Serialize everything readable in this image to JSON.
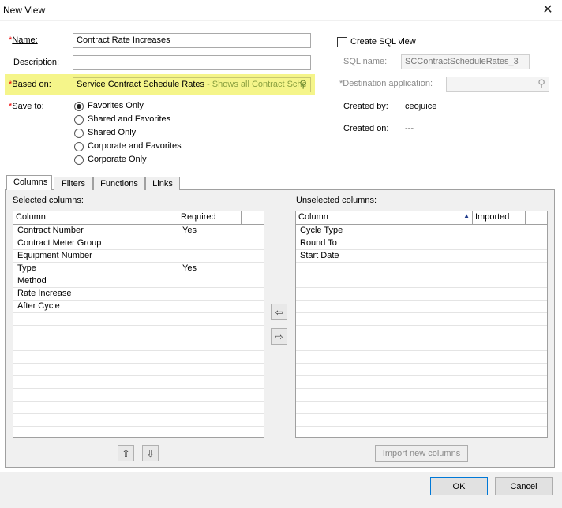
{
  "window": {
    "title": "New View",
    "close_glyph": "✕"
  },
  "form": {
    "name_label": "Name:",
    "name_value": "Contract Rate Increases",
    "description_label": "Description:",
    "description_value": "",
    "based_on_label": "Based on:",
    "based_on_value": "Service Contract Schedule Rates",
    "based_on_hint": " - Shows all Contract Sche",
    "save_to_label": "Save to:",
    "save_to_options": [
      "Favorites Only",
      "Shared and Favorites",
      "Shared Only",
      "Corporate and Favorites",
      "Corporate Only"
    ],
    "save_to_selected": "Favorites Only",
    "asterisk": "*"
  },
  "sql": {
    "create_label": "Create SQL view",
    "create_checked": false,
    "sql_name_label": "SQL name:",
    "sql_name_value": "SCContractScheduleRates_3",
    "destination_label": "*Destination application:",
    "destination_value": "",
    "created_by_label": "Created by:",
    "created_by_value": "ceojuice",
    "created_on_label": "Created on:",
    "created_on_value": "---"
  },
  "tabs": [
    "Columns",
    "Filters",
    "Functions",
    "Links"
  ],
  "active_tab": "Columns",
  "selected": {
    "label": "Selected columns:",
    "headers": [
      "Column",
      "Required"
    ],
    "rows": [
      [
        "Contract Number",
        "Yes"
      ],
      [
        "Contract Meter Group",
        ""
      ],
      [
        "Equipment Number",
        ""
      ],
      [
        "Type",
        "Yes"
      ],
      [
        "Method",
        ""
      ],
      [
        "Rate Increase",
        ""
      ],
      [
        "After Cycle",
        ""
      ]
    ]
  },
  "unselected": {
    "label": "Unselected columns:",
    "headers": [
      "Column",
      "Imported"
    ],
    "sort_glyph": "▲",
    "rows": [
      [
        "Cycle Type",
        ""
      ],
      [
        "Round To",
        ""
      ],
      [
        "Start Date",
        ""
      ]
    ]
  },
  "buttons": {
    "import_new_columns": "Import new columns",
    "ok": "OK",
    "cancel": "Cancel"
  },
  "icons": {
    "search": "⚲",
    "arrow_left": "⇦",
    "arrow_right": "⇨",
    "arrow_up": "⇧",
    "arrow_down": "⇩"
  }
}
